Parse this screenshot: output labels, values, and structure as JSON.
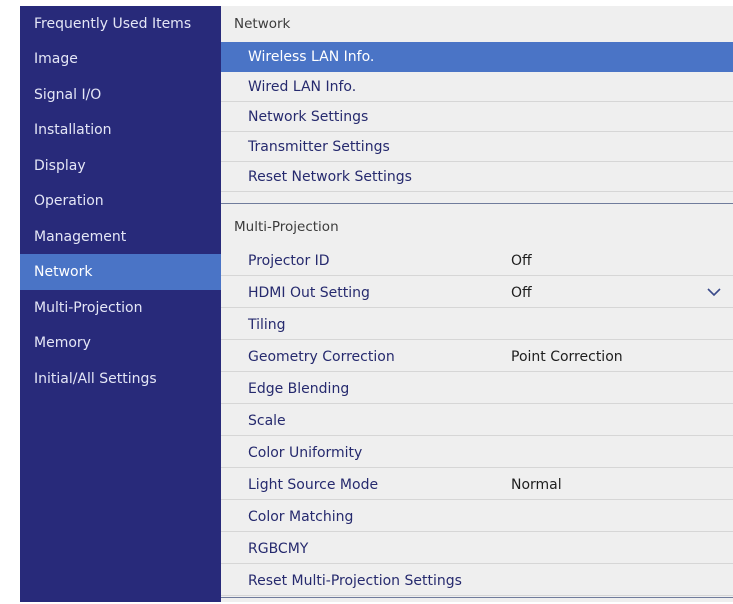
{
  "sidebar": {
    "items": [
      {
        "label": "Frequently Used Items",
        "selected": false
      },
      {
        "label": "Image",
        "selected": false
      },
      {
        "label": "Signal I/O",
        "selected": false
      },
      {
        "label": "Installation",
        "selected": false
      },
      {
        "label": "Display",
        "selected": false
      },
      {
        "label": "Operation",
        "selected": false
      },
      {
        "label": "Management",
        "selected": false
      },
      {
        "label": "Network",
        "selected": true
      },
      {
        "label": "Multi-Projection",
        "selected": false
      },
      {
        "label": "Memory",
        "selected": false
      },
      {
        "label": "Initial/All Settings",
        "selected": false
      }
    ]
  },
  "sections": [
    {
      "title": "Network",
      "rows": [
        {
          "label": "Wireless LAN Info.",
          "value": "",
          "selected": true
        },
        {
          "label": "Wired LAN Info.",
          "value": ""
        },
        {
          "label": "Network Settings",
          "value": ""
        },
        {
          "label": "Transmitter Settings",
          "value": ""
        },
        {
          "label": "Reset Network Settings",
          "value": ""
        }
      ]
    },
    {
      "title": "Multi-Projection",
      "rows": [
        {
          "label": "Projector ID",
          "value": "Off"
        },
        {
          "label": "HDMI Out Setting",
          "value": "Off",
          "icon": "chevron-down-icon"
        },
        {
          "label": "Tiling",
          "value": ""
        },
        {
          "label": "Geometry Correction",
          "value": "Point Correction"
        },
        {
          "label": "Edge Blending",
          "value": ""
        },
        {
          "label": "Scale",
          "value": ""
        },
        {
          "label": "Color Uniformity",
          "value": ""
        },
        {
          "label": "Light Source Mode",
          "value": "Normal"
        },
        {
          "label": "Color Matching",
          "value": ""
        },
        {
          "label": "RGBCMY",
          "value": ""
        },
        {
          "label": "Reset Multi-Projection Settings",
          "value": ""
        }
      ]
    }
  ],
  "colors": {
    "sidebar_bg": "#282a7a",
    "selected_bg": "#4a74c6",
    "content_bg": "#efefef",
    "item_text": "#262a6e"
  }
}
